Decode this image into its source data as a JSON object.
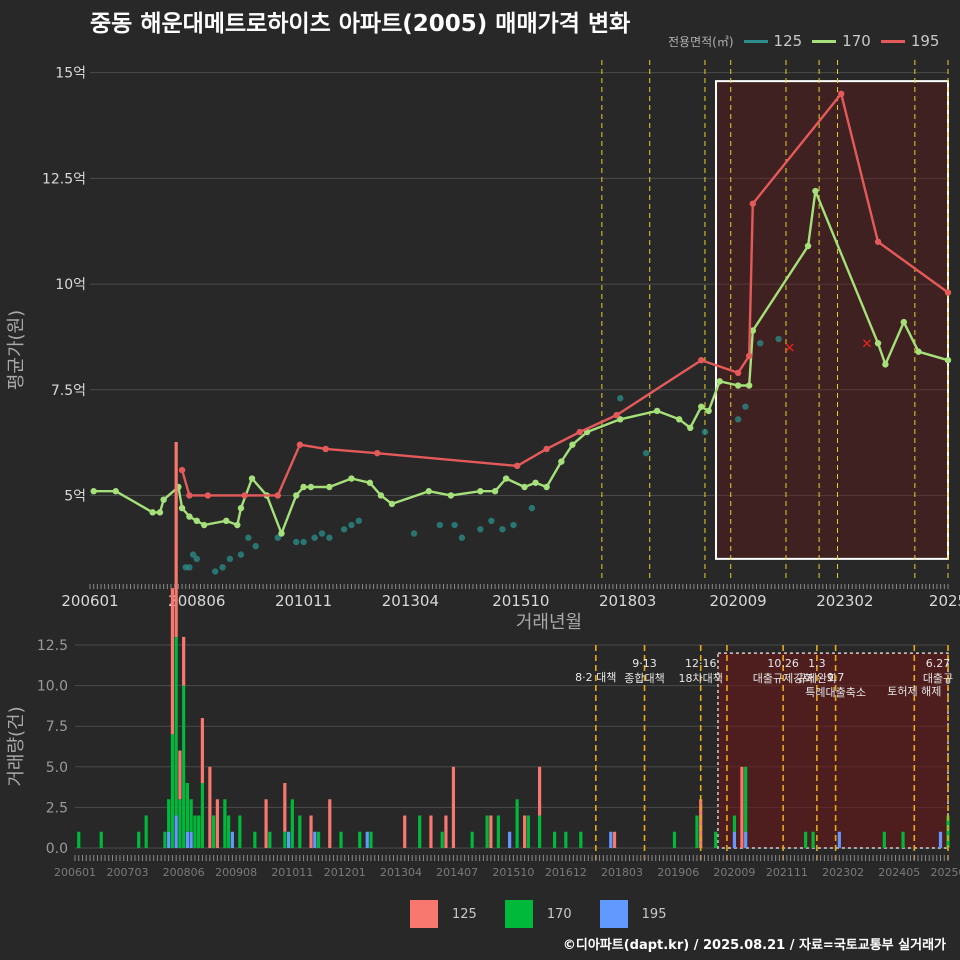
{
  "title": "중동 해운대메트로하이츠 아파트(2005) 매매가격 변화",
  "legend": {
    "title": "전용면적(㎡)",
    "items": [
      {
        "label": "125",
        "color": "#2a8f8b"
      },
      {
        "label": "170",
        "color": "#a5e07a"
      },
      {
        "label": "195",
        "color": "#e45a5a"
      }
    ]
  },
  "volume_legend": [
    {
      "label": "125",
      "color": "#f87870"
    },
    {
      "label": "170",
      "color": "#00b93a"
    },
    {
      "label": "195",
      "color": "#6299ff"
    }
  ],
  "footer": "©디아파트(dapt.kr) / 2025.08.21 / 자료=국토교통부 실거래가",
  "chart_data": [
    {
      "type": "line",
      "xlabel": "거래년월",
      "ylabel": "평균가(원)",
      "ylim": [
        3.0,
        15.3
      ],
      "yticks": [
        5,
        7.5,
        10,
        12.5,
        15
      ],
      "ytick_labels": [
        "5억",
        "7.5억",
        "10억",
        "12.5억",
        "15억"
      ],
      "xlim": [
        "2006-01",
        "2025-06"
      ],
      "xticks": [
        "2006-01",
        "2008-06",
        "2010-11",
        "2013-04",
        "2015-10",
        "2018-03",
        "2020-09",
        "2023-02",
        "2025-06"
      ],
      "xtick_labels": [
        "200601",
        "200806",
        "201011",
        "201304",
        "201510",
        "201803",
        "202009",
        "202302",
        "2025"
      ],
      "highlight": {
        "from": "2020-03",
        "to": "2025-06",
        "ymin": 3.5,
        "ymax": 14.8
      },
      "policy_lines": [
        "2017-08",
        "2018-09",
        "2019-12",
        "2020-07",
        "2021-10",
        "2022-07",
        "2022-12",
        "2024-09",
        "2025-06"
      ],
      "series": [
        {
          "name": "125",
          "color": "#2a8f8b",
          "points": [
            [
              "2008-03",
              3.3
            ],
            [
              "2008-04",
              3.3
            ],
            [
              "2008-05",
              3.6
            ],
            [
              "2008-06",
              3.5
            ],
            [
              "2008-11",
              3.2
            ],
            [
              "2009-01",
              3.3
            ],
            [
              "2009-03",
              3.5
            ],
            [
              "2009-06",
              3.6
            ],
            [
              "2009-08",
              4.0
            ],
            [
              "2009-10",
              3.8
            ],
            [
              "2010-04",
              4.0
            ],
            [
              "2010-09",
              3.9
            ],
            [
              "2010-11",
              3.9
            ],
            [
              "2011-02",
              4.0
            ],
            [
              "2011-04",
              4.1
            ],
            [
              "2011-06",
              4.0
            ],
            [
              "2011-10",
              4.2
            ],
            [
              "2011-12",
              4.3
            ],
            [
              "2012-02",
              4.4
            ],
            [
              "2013-05",
              4.1
            ],
            [
              "2013-12",
              4.3
            ],
            [
              "2014-04",
              4.3
            ],
            [
              "2014-06",
              4.0
            ],
            [
              "2014-11",
              4.2
            ],
            [
              "2015-02",
              4.4
            ],
            [
              "2015-05",
              4.2
            ],
            [
              "2015-08",
              4.3
            ],
            [
              "2016-01",
              4.7
            ],
            [
              "2018-08",
              6.0
            ],
            [
              "2018-01",
              7.3
            ],
            [
              "2019-12",
              6.5
            ],
            [
              "2020-09",
              6.8
            ],
            [
              "2020-11",
              7.1
            ],
            [
              "2021-03",
              8.6
            ],
            [
              "2021-08",
              8.7
            ]
          ]
        },
        {
          "name": "170",
          "color": "#a5e07a",
          "points": [
            [
              "2006-02",
              5.1
            ],
            [
              "2006-08",
              5.1
            ],
            [
              "2007-06",
              4.6
            ],
            [
              "2007-08",
              4.6
            ],
            [
              "2007-09",
              4.9
            ],
            [
              "2008-01",
              5.2
            ],
            [
              "2008-02",
              4.7
            ],
            [
              "2008-04",
              4.5
            ],
            [
              "2008-06",
              4.4
            ],
            [
              "2008-08",
              4.3
            ],
            [
              "2009-02",
              4.4
            ],
            [
              "2009-05",
              4.3
            ],
            [
              "2009-06",
              4.7
            ],
            [
              "2009-09",
              5.4
            ],
            [
              "2010-01",
              5.0
            ],
            [
              "2010-05",
              4.1
            ],
            [
              "2010-09",
              5.0
            ],
            [
              "2010-11",
              5.2
            ],
            [
              "2011-01",
              5.2
            ],
            [
              "2011-06",
              5.2
            ],
            [
              "2011-12",
              5.4
            ],
            [
              "2012-05",
              5.3
            ],
            [
              "2012-08",
              5.0
            ],
            [
              "2012-11",
              4.8
            ],
            [
              "2013-09",
              5.1
            ],
            [
              "2014-03",
              5.0
            ],
            [
              "2014-11",
              5.1
            ],
            [
              "2015-03",
              5.1
            ],
            [
              "2015-06",
              5.4
            ],
            [
              "2015-11",
              5.2
            ],
            [
              "2016-02",
              5.3
            ],
            [
              "2016-05",
              5.2
            ],
            [
              "2016-09",
              5.8
            ],
            [
              "2016-12",
              6.2
            ],
            [
              "2017-04",
              6.5
            ],
            [
              "2018-01",
              6.8
            ],
            [
              "2018-11",
              7.0
            ],
            [
              "2019-05",
              6.8
            ],
            [
              "2019-08",
              6.6
            ],
            [
              "2019-11",
              7.1
            ],
            [
              "2020-01",
              7.0
            ],
            [
              "2020-04",
              7.7
            ],
            [
              "2020-09",
              7.6
            ],
            [
              "2020-12",
              7.6
            ],
            [
              "2021-01",
              8.9
            ],
            [
              "2022-04",
              10.9
            ],
            [
              "2022-06",
              12.2
            ],
            [
              "2023-11",
              8.6
            ],
            [
              "2024-01",
              8.1
            ],
            [
              "2024-06",
              9.1
            ],
            [
              "2024-10",
              8.4
            ],
            [
              "2025-06",
              8.2
            ]
          ]
        },
        {
          "name": "195",
          "color": "#e45a5a",
          "points": [
            [
              "2008-02",
              5.6
            ],
            [
              "2008-04",
              5.0
            ],
            [
              "2008-09",
              5.0
            ],
            [
              "2009-07",
              5.0
            ],
            [
              "2010-04",
              5.0
            ],
            [
              "2010-10",
              6.2
            ],
            [
              "2011-05",
              6.1
            ],
            [
              "2012-07",
              6.0
            ],
            [
              "2015-09",
              5.7
            ],
            [
              "2016-05",
              6.1
            ],
            [
              "2017-02",
              6.5
            ],
            [
              "2017-12",
              6.9
            ],
            [
              "2019-11",
              8.2
            ],
            [
              "2020-09",
              7.9
            ],
            [
              "2020-12",
              8.3
            ],
            [
              "2021-01",
              11.9
            ],
            [
              "2023-01",
              14.5
            ],
            [
              "2023-11",
              11.0
            ],
            [
              "2025-06",
              9.8
            ]
          ]
        }
      ],
      "markers": [
        {
          "series": "195",
          "x": "2021-11",
          "y": 8.5,
          "symbol": "x"
        },
        {
          "series": "195",
          "x": "2023-08",
          "y": 8.6,
          "symbol": "x"
        }
      ]
    },
    {
      "type": "bar",
      "stacked": true,
      "ylabel": "거래량(건)",
      "ylim": [
        0,
        12.5
      ],
      "yticks": [
        0.0,
        2.5,
        5.0,
        7.5,
        10.0,
        12.5
      ],
      "ytick_labels": [
        "0.0",
        "2.5",
        "5.0",
        "7.5",
        "10.0",
        "12.5"
      ],
      "xlim": [
        "2006-01",
        "2025-06"
      ],
      "xticks": [
        "2006-01",
        "2007-03",
        "2008-06",
        "2009-08",
        "2010-11",
        "2012-01",
        "2013-04",
        "2014-07",
        "2015-10",
        "2016-12",
        "2018-03",
        "2019-06",
        "2020-09",
        "2021-11",
        "2023-02",
        "2024-05",
        "2025-06"
      ],
      "xtick_labels": [
        "200601",
        "200703",
        "200806",
        "200908",
        "201011",
        "201201",
        "201304",
        "201407",
        "201510",
        "201612",
        "201803",
        "201906",
        "202009",
        "202111",
        "202302",
        "202405",
        "20250"
      ],
      "highlight": {
        "from": "2020-03",
        "to": "2025-06",
        "ymin": 0,
        "ymax": 12.0
      },
      "annotations": [
        {
          "x": "2017-08",
          "label": "8·2 대책",
          "row": 1
        },
        {
          "x": "2018-09",
          "label": "9·13\n종합대책",
          "row": 0
        },
        {
          "x": "2019-12",
          "label": "12·16\n18차대책",
          "row": 0
        },
        {
          "x": "2020-07",
          "label": "",
          "row": 0
        },
        {
          "x": "2021-10",
          "label": "10.26\n대출규제강화",
          "row": 0
        },
        {
          "x": "2022-07",
          "label": "1.3\n규제완화",
          "row": 0
        },
        {
          "x": "2022-12",
          "label": "9.7\n특례대출축소",
          "row": 1
        },
        {
          "x": "2024-09",
          "label": "토허제 해제",
          "row": 2
        },
        {
          "x": "2025-06",
          "label": "6.27\n대출규",
          "row": 0
        }
      ],
      "series": [
        {
          "name": "125",
          "color": "#f87870",
          "values": {
            "2008-03": 9,
            "2008-04": 12,
            "2008-05": 3,
            "2008-06": 3,
            "2008-11": 4,
            "2009-01": 5,
            "2009-03": 3,
            "2010-04": 3,
            "2010-09": 3,
            "2011-04": 2,
            "2011-09": 3,
            "2013-05": 2,
            "2013-12": 2,
            "2014-04": 2,
            "2014-06": 5,
            "2015-04": 2,
            "2016-01": 2,
            "2016-05": 3,
            "2018-01": 1,
            "2019-12": 3,
            "2020-11": 5
          }
        },
        {
          "name": "170",
          "color": "#00b93a",
          "values": {
            "2006-02": 1,
            "2006-08": 1,
            "2007-06": 1,
            "2007-08": 2,
            "2008-01": 1,
            "2008-02": 2,
            "2008-03": 7,
            "2008-04": 11,
            "2008-05": 3,
            "2008-06": 10,
            "2008-07": 3,
            "2008-08": 2,
            "2008-09": 2,
            "2008-10": 2,
            "2008-11": 4,
            "2009-02": 2,
            "2009-05": 3,
            "2009-06": 2,
            "2009-09": 2,
            "2010-01": 1,
            "2010-05": 1,
            "2010-09": 1,
            "2010-11": 3,
            "2011-01": 2,
            "2011-06": 1,
            "2011-12": 1,
            "2012-05": 1,
            "2012-08": 1,
            "2013-09": 2,
            "2014-03": 1,
            "2014-11": 1,
            "2015-03": 2,
            "2015-06": 2,
            "2015-11": 3,
            "2016-02": 2,
            "2016-05": 2,
            "2016-09": 1,
            "2016-12": 1,
            "2017-04": 1,
            "2019-05": 1,
            "2019-11": 2,
            "2020-04": 1,
            "2020-09": 1,
            "2020-12": 4,
            "2022-04": 1,
            "2022-06": 1,
            "2024-01": 1,
            "2024-06": 1,
            "2025-06": 2
          }
        },
        {
          "name": "195",
          "color": "#6299ff",
          "values": {
            "2008-02": 1,
            "2008-04": 2,
            "2008-07": 1,
            "2008-08": 1,
            "2009-07": 1,
            "2010-10": 1,
            "2011-05": 1,
            "2012-07": 1,
            "2015-09": 1,
            "2017-12": 1,
            "2020-09": 1,
            "2020-12": 1,
            "2023-01": 1,
            "2025-04": 1
          }
        }
      ]
    }
  ]
}
